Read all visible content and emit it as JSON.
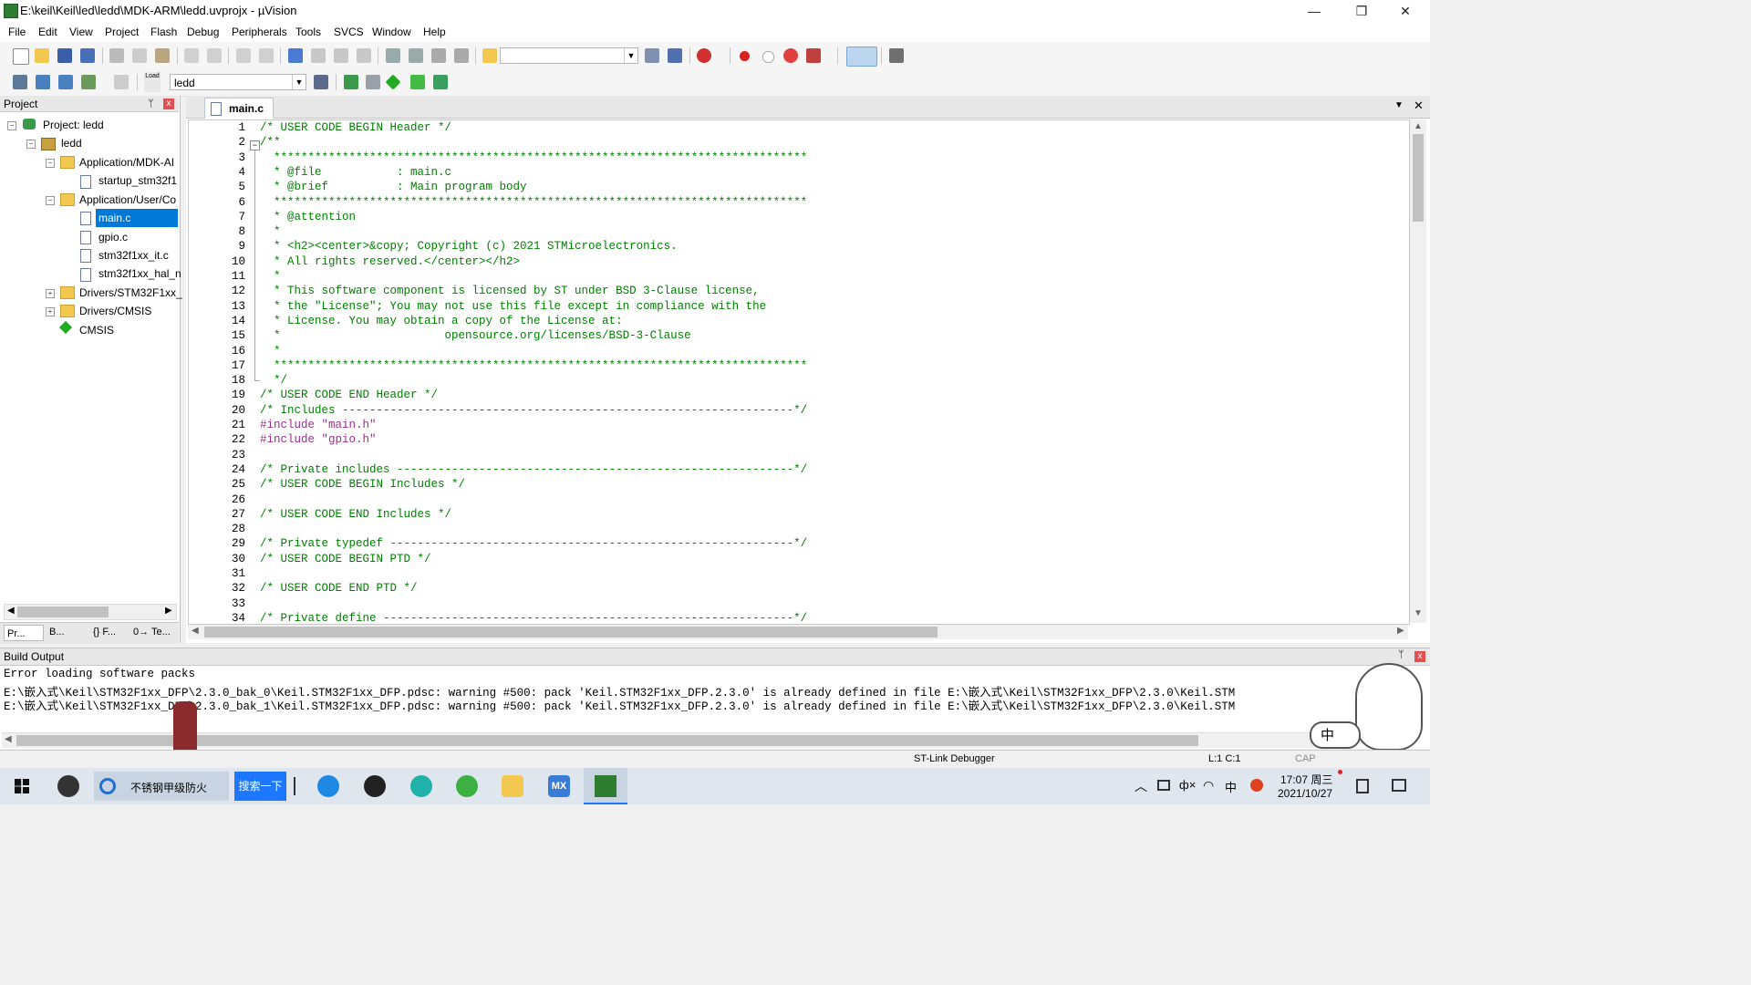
{
  "window": {
    "title": "E:\\keil\\Keil\\led\\ledd\\MDK-ARM\\ledd.uvprojx - µVision",
    "minimize": "—",
    "maximize": "❐",
    "close": "✕"
  },
  "menu": [
    "File",
    "Edit",
    "View",
    "Project",
    "Flash",
    "Debug",
    "Peripherals",
    "Tools",
    "SVCS",
    "Window",
    "Help"
  ],
  "toolbar2": {
    "load_label": "Load",
    "target_value": "ledd"
  },
  "project_panel": {
    "title": "Project",
    "pin": "ᛘ",
    "close": "x",
    "tree": [
      {
        "label": "Project: ledd",
        "level": 0
      },
      {
        "label": "ledd",
        "level": 1
      },
      {
        "label": "Application/MDK-AI",
        "level": 2
      },
      {
        "label": "startup_stm32f1",
        "level": 3
      },
      {
        "label": "Application/User/Co",
        "level": 2
      },
      {
        "label": "main.c",
        "level": 3,
        "selected": true
      },
      {
        "label": "gpio.c",
        "level": 3
      },
      {
        "label": "stm32f1xx_it.c",
        "level": 3
      },
      {
        "label": "stm32f1xx_hal_n",
        "level": 3
      },
      {
        "label": "Drivers/STM32F1xx_",
        "level": 2
      },
      {
        "label": "Drivers/CMSIS",
        "level": 2
      },
      {
        "label": "CMSIS",
        "level": 2
      }
    ],
    "bottom_tabs": [
      "Pr...",
      "B...",
      "{} F...",
      "0→ Te..."
    ]
  },
  "editor": {
    "tab_label": "main.c",
    "lines": [
      {
        "n": "1",
        "text": "/* USER CODE BEGIN Header */"
      },
      {
        "n": "2",
        "text": "/**"
      },
      {
        "n": "3",
        "text": "  ******************************************************************************"
      },
      {
        "n": "4",
        "text": "  * @file           : main.c"
      },
      {
        "n": "5",
        "text": "  * @brief          : Main program body"
      },
      {
        "n": "6",
        "text": "  ******************************************************************************"
      },
      {
        "n": "7",
        "text": "  * @attention"
      },
      {
        "n": "8",
        "text": "  *"
      },
      {
        "n": "9",
        "text": "  * <h2><center>&copy; Copyright (c) 2021 STMicroelectronics."
      },
      {
        "n": "10",
        "text": "  * All rights reserved.</center></h2>"
      },
      {
        "n": "11",
        "text": "  *"
      },
      {
        "n": "12",
        "text": "  * This software component is licensed by ST under BSD 3-Clause license,"
      },
      {
        "n": "13",
        "text": "  * the \"License\"; You may not use this file except in compliance with the"
      },
      {
        "n": "14",
        "text": "  * License. You may obtain a copy of the License at:"
      },
      {
        "n": "15",
        "text": "  *                        opensource.org/licenses/BSD-3-Clause"
      },
      {
        "n": "16",
        "text": "  *"
      },
      {
        "n": "17",
        "text": "  ******************************************************************************"
      },
      {
        "n": "18",
        "text": "  */"
      },
      {
        "n": "19",
        "text": "/* USER CODE END Header */"
      },
      {
        "n": "20",
        "text": "/* Includes ------------------------------------------------------------------*/"
      },
      {
        "n": "21",
        "text": "#include \"main.h\""
      },
      {
        "n": "22",
        "text": "#include \"gpio.h\""
      },
      {
        "n": "23",
        "text": ""
      },
      {
        "n": "24",
        "text": "/* Private includes ----------------------------------------------------------*/"
      },
      {
        "n": "25",
        "text": "/* USER CODE BEGIN Includes */"
      },
      {
        "n": "26",
        "text": ""
      },
      {
        "n": "27",
        "text": "/* USER CODE END Includes */"
      },
      {
        "n": "28",
        "text": ""
      },
      {
        "n": "29",
        "text": "/* Private typedef -----------------------------------------------------------*/"
      },
      {
        "n": "30",
        "text": "/* USER CODE BEGIN PTD */"
      },
      {
        "n": "31",
        "text": ""
      },
      {
        "n": "32",
        "text": "/* USER CODE END PTD */"
      },
      {
        "n": "33",
        "text": ""
      },
      {
        "n": "34",
        "text": "/* Private define ------------------------------------------------------------*/"
      }
    ]
  },
  "build_output": {
    "title": "Build Output",
    "lines": [
      "Error loading software packs",
      "E:\\嵌入式\\Keil\\STM32F1xx_DFP\\2.3.0_bak_0\\Keil.STM32F1xx_DFP.pdsc: warning #500: pack 'Keil.STM32F1xx_DFP.2.3.0' is already defined in file E:\\嵌入式\\Keil\\STM32F1xx_DFP\\2.3.0\\Keil.STM",
      "E:\\嵌入式\\Keil\\STM32F1xx_DFP\\2.3.0_bak_1\\Keil.STM32F1xx_DFP.pdsc: warning #500: pack 'Keil.STM32F1xx_DFP.2.3.0' is already defined in file E:\\嵌入式\\Keil\\STM32F1xx_DFP\\2.3.0\\Keil.STM"
    ]
  },
  "status": {
    "debugger": "ST-Link Debugger",
    "position": "L:1 C:1",
    "caps": "CAP"
  },
  "taskbar": {
    "browser_tab": "不锈钢甲级防火",
    "search_button": "搜索一下",
    "mx_label": "MX",
    "time": "17:07 周三",
    "date": "2021/10/27",
    "ime": "中",
    "sound": "ф×",
    "ime2": "中"
  },
  "colors": {
    "comment": "#008000",
    "preprocessor": "#9b2e8e",
    "selection": "#0078d7",
    "search_btn": "#1e78ff"
  }
}
